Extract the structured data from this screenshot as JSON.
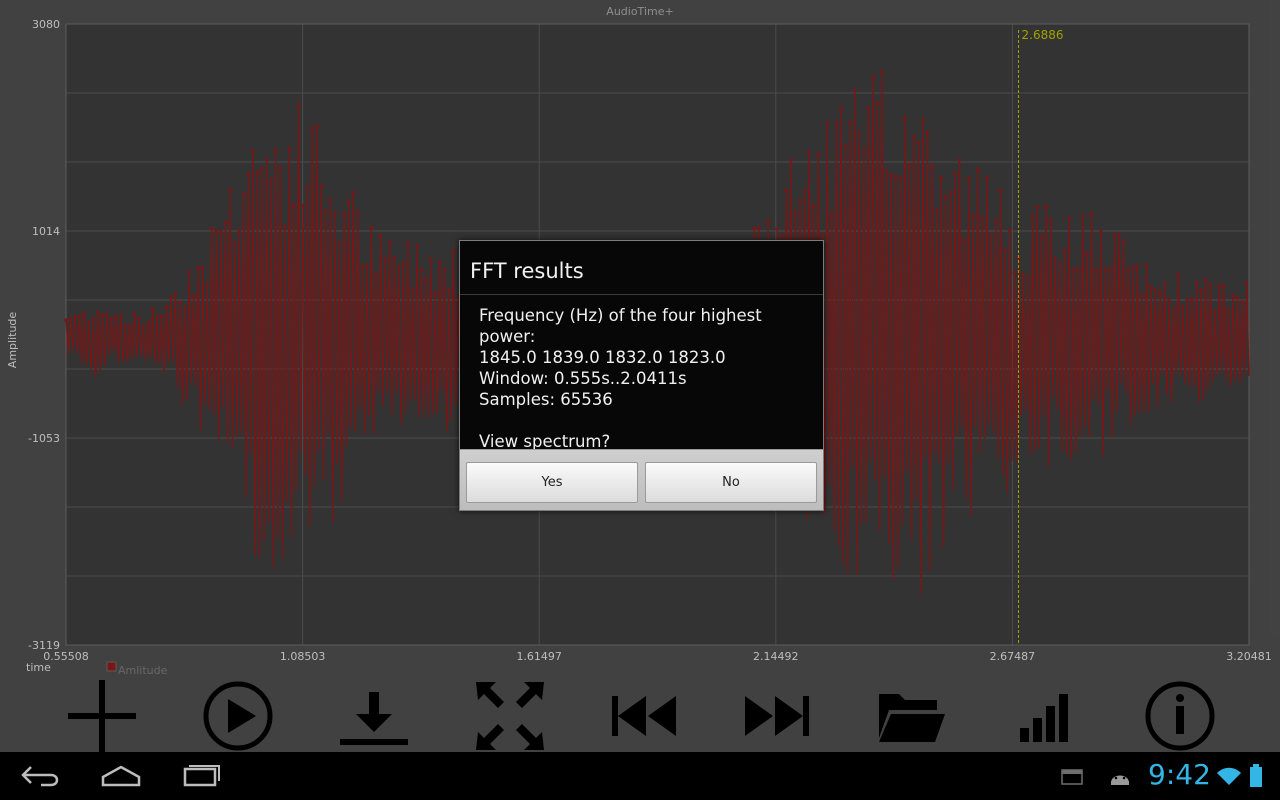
{
  "app": {
    "title": "AudioTime+"
  },
  "chart_data": {
    "type": "line",
    "title": "",
    "xlabel": "time",
    "ylabel": "Amplitude",
    "legend": "Amlitude",
    "legend_placement": "bottom-left",
    "xlim": [
      0.55508,
      3.20481
    ],
    "ylim": [
      -3119,
      3080
    ],
    "x_ticks": [
      "0.55508",
      "1.08503",
      "1.61497",
      "2.14492",
      "2.67487",
      "3.20481"
    ],
    "y_ticks": [
      "3080",
      "1014",
      "-1053",
      "-3119"
    ],
    "grid": true,
    "series_color": "#8b1a1a",
    "cursor": {
      "x": 2.6886,
      "label": "2.6886",
      "color": "#b8b800"
    },
    "series": [
      {
        "name": "Amlitude",
        "x_start": 0.55508,
        "x_end": 3.20481,
        "envelope": [
          [
            0.555,
            250
          ],
          [
            0.62,
            380
          ],
          [
            0.74,
            220
          ],
          [
            0.85,
            900
          ],
          [
            0.97,
            2300
          ],
          [
            1.1,
            2400
          ],
          [
            1.25,
            1050
          ],
          [
            1.4,
            1000
          ],
          [
            1.55,
            600
          ],
          [
            1.75,
            500
          ],
          [
            2.05,
            950
          ],
          [
            2.12,
            1500
          ],
          [
            2.3,
            2550
          ],
          [
            2.45,
            2850
          ],
          [
            2.52,
            2100
          ],
          [
            2.62,
            1700
          ],
          [
            2.7,
            1350
          ],
          [
            2.85,
            1300
          ],
          [
            3.0,
            700
          ],
          [
            3.2,
            550
          ]
        ]
      }
    ]
  },
  "toolbar": {
    "items": [
      {
        "name": "add-icon"
      },
      {
        "name": "play-icon"
      },
      {
        "name": "download-icon"
      },
      {
        "name": "fullscreen-icon"
      },
      {
        "name": "skip-back-icon"
      },
      {
        "name": "skip-forward-icon"
      },
      {
        "name": "folder-icon"
      },
      {
        "name": "signal-bars-icon"
      },
      {
        "name": "info-icon"
      }
    ]
  },
  "dialog": {
    "title": "FFT results",
    "line1": "Frequency (Hz) of the four highest power:",
    "line2": "1845.0 1839.0 1832.0 1823.0",
    "line3": "Window: 0.555s..2.0411s",
    "line4": "Samples: 65536",
    "line5": "View spectrum?",
    "yes_label": "Yes",
    "no_label": "No"
  },
  "status_bar": {
    "time": "9:42",
    "accent_color": "#33b5e5"
  }
}
